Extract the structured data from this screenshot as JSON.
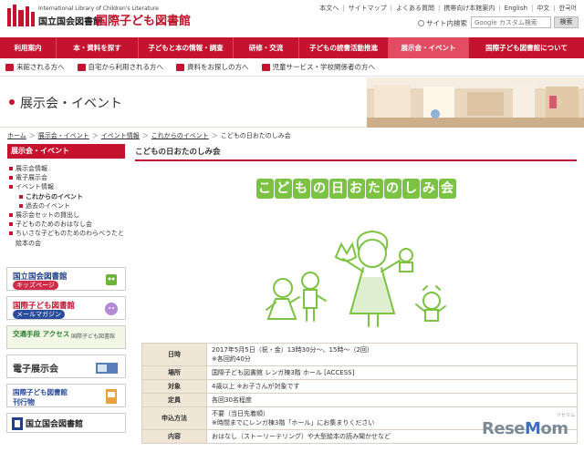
{
  "header": {
    "logo_en": "International Library of Children's Literature",
    "logo_ja_ndl": "国立国会図書館",
    "logo_ja_ilcl": "国際子ども図書館",
    "util_links": [
      "本文へ",
      "サイトマップ",
      "よくある質問",
      "携帯向け本館案内",
      "English",
      "中文",
      "한국어"
    ],
    "search_radio_label": "サイト内検索",
    "search_placeholder": "Google カスタム検索",
    "search_button": "検索"
  },
  "nav": {
    "items": [
      "利用案内",
      "本・資料を探す",
      "子どもと本の情報・調査",
      "研修・交流",
      "子どもの読書活動推進",
      "展示会・イベント",
      "国際子ども図書館について"
    ],
    "active_index": 5
  },
  "subnav": {
    "items": [
      "来館される方へ",
      "自宅から利用される方へ",
      "資料をお探しの方へ",
      "児童サービス・学校関係者の方へ"
    ]
  },
  "banner": {
    "title": "展示会・イベント"
  },
  "breadcrumb": {
    "items": [
      "ホーム",
      "展示会・イベント",
      "イベント情報",
      "これからのイベント",
      "こどもの日おたのしみ会"
    ]
  },
  "sidebar": {
    "heading": "展示会・イベント",
    "items": [
      {
        "label": "展示会情報",
        "level": 1
      },
      {
        "label": "電子展示会",
        "level": 1
      },
      {
        "label": "イベント情報",
        "level": 1
      },
      {
        "label": "これからのイベント",
        "level": 2,
        "current": true
      },
      {
        "label": "過去のイベント",
        "level": 2
      },
      {
        "label": "展示会セットの貸出し",
        "level": 1
      },
      {
        "label": "子どものためのおはなし会",
        "level": 1
      },
      {
        "label": "ちいさな子どものためのわらべうたと絵本の会",
        "level": 1
      }
    ],
    "banners": [
      {
        "title": "国立国会図書館",
        "sub": "キッズページ"
      },
      {
        "title": "国際子ども図書館",
        "sub": "メールマガジン"
      },
      {
        "title": "交通手段 アクセス",
        "sub": "国際子ども図書館"
      },
      {
        "title": "電子展示会",
        "sub": ""
      },
      {
        "title": "国際子ども図書館",
        "sub": "刊行物"
      },
      {
        "title": "国立国会図書館",
        "sub": ""
      }
    ]
  },
  "content": {
    "title": "こどもの日おたのしみ会",
    "illustration_title": "こどもの日おたのしみ会",
    "details": [
      {
        "label": "日時",
        "lines": [
          "2017年5月5日（祝・金）13時30分～、15時～（2回）",
          "※各回約40分"
        ]
      },
      {
        "label": "場所",
        "lines": [
          "国際子ども図書館 レンガ棟3階 ホール [ACCESS]"
        ]
      },
      {
        "label": "対象",
        "lines": [
          "4歳以上 ※お子さんが対象です"
        ]
      },
      {
        "label": "定員",
        "lines": [
          "各回30名程度"
        ]
      },
      {
        "label": "申込方法",
        "lines": [
          "不要（当日先着順）",
          "※時間までにレンガ棟3階「ホール」にお集まりください"
        ]
      },
      {
        "label": "内容",
        "lines": [
          "おはなし（ストーリーテリング）や大型絵本の読み聞かせなど"
        ]
      }
    ]
  },
  "watermark": "ReseMom",
  "colors": {
    "brand_red": "#c4122f",
    "table_label_bg": "#efe6d6",
    "illust_green": "#7cc343"
  }
}
